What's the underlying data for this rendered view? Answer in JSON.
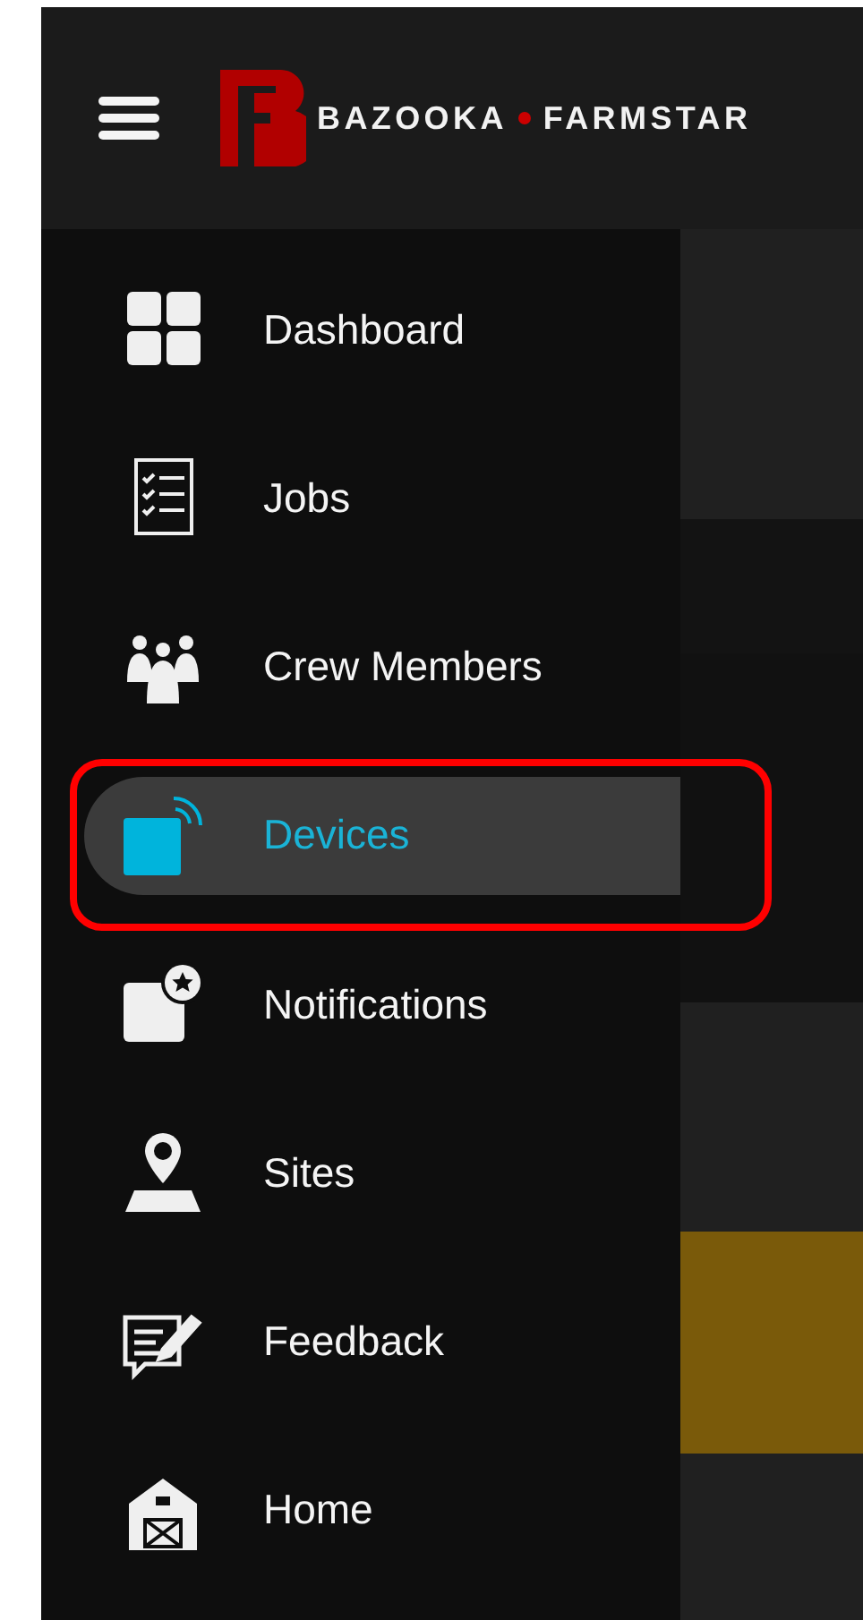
{
  "header": {
    "brand_left": "BAZOOKA",
    "brand_right": "FARMSTAR"
  },
  "sidebar": {
    "items": [
      {
        "label": "Dashboard",
        "selected": false,
        "highlighted": false
      },
      {
        "label": "Jobs",
        "selected": false,
        "highlighted": false
      },
      {
        "label": "Crew Members",
        "selected": false,
        "highlighted": false
      },
      {
        "label": "Devices",
        "selected": true,
        "highlighted": true
      },
      {
        "label": "Notifications",
        "selected": false,
        "highlighted": false
      },
      {
        "label": "Sites",
        "selected": false,
        "highlighted": false
      },
      {
        "label": "Feedback",
        "selected": false,
        "highlighted": false
      },
      {
        "label": "Home",
        "selected": false,
        "highlighted": false
      }
    ]
  },
  "content": {
    "panels": [
      {
        "kind": "card"
      },
      {
        "kind": "dark"
      },
      {
        "kind": "plain"
      },
      {
        "kind": "card"
      },
      {
        "kind": "accent"
      },
      {
        "kind": "card"
      }
    ]
  }
}
